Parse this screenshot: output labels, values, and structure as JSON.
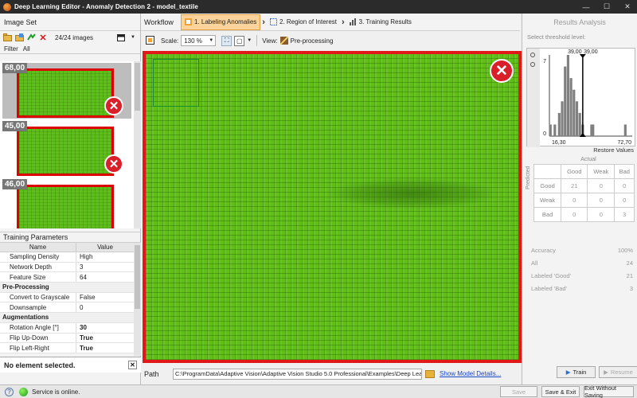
{
  "window": {
    "title": "Deep Learning Editor - Anomaly Detection 2 - model_textile",
    "minimize": "—",
    "maximize": "☐",
    "close": "✕"
  },
  "image_set": {
    "title": "Image Set",
    "count_label": "24/24 images",
    "filter_label": "Filter",
    "filter_value": "All",
    "thumbnails": [
      {
        "score": "68,00",
        "label": "bad",
        "selected": true
      },
      {
        "score": "45,00",
        "label": "bad",
        "selected": false
      },
      {
        "score": "46,00",
        "label": "bad",
        "selected": false
      }
    ]
  },
  "training_parameters": {
    "title": "Training Parameters",
    "col_name": "Name",
    "col_value": "Value",
    "rows": [
      {
        "type": "row",
        "name": "Sampling Density",
        "value": "High",
        "bold": false
      },
      {
        "type": "row",
        "name": "Network Depth",
        "value": "3",
        "bold": false
      },
      {
        "type": "row",
        "name": "Feature Size",
        "value": "64",
        "bold": false
      },
      {
        "type": "section",
        "name": "Pre-Processing"
      },
      {
        "type": "row",
        "name": "Convert to Grayscale",
        "value": "False",
        "bold": false
      },
      {
        "type": "row",
        "name": "Downsample",
        "value": "0",
        "bold": false
      },
      {
        "type": "section",
        "name": "Augmentations"
      },
      {
        "type": "row",
        "name": "Rotation Angle [°]",
        "value": "30",
        "bold": true
      },
      {
        "type": "row",
        "name": "Flip Up-Down",
        "value": "True",
        "bold": true
      },
      {
        "type": "row",
        "name": "Flip Left-Right",
        "value": "True",
        "bold": true
      }
    ],
    "no_selection": "No element selected."
  },
  "workflow": {
    "label": "Workflow",
    "steps": [
      {
        "label": "1. Labeling Anomalies",
        "active": true
      },
      {
        "label": "2. Region of Interest",
        "active": false
      },
      {
        "label": "3. Training Results",
        "active": false
      }
    ]
  },
  "view": {
    "scale_label": "Scale:",
    "scale_value": "130 %",
    "view_label": "View:",
    "preprocessing_label": "Pre-processing"
  },
  "path": {
    "label": "Path",
    "value": "C:\\ProgramData\\Adaptive Vision\\Adaptive Vision Studio 5.0 Professional\\Examples\\Deep Learning - Textiles",
    "details_link": "Show Model Details..."
  },
  "results": {
    "title": "Results Analysis",
    "threshold_label": "Select threshold level:",
    "threshold_left": "39,00",
    "threshold_right": "39,00",
    "axis_min": "16,30",
    "axis_max": "72,70",
    "y_max": "7",
    "y_min": "0",
    "restore_label": "Restore Values",
    "actual_label": "Actual",
    "predicted_label": "Predicted",
    "matrix_headers": [
      "Good",
      "Weak",
      "Bad"
    ],
    "matrix_rows": [
      {
        "label": "Good",
        "values": [
          "21",
          "0",
          "0"
        ]
      },
      {
        "label": "Weak",
        "values": [
          "0",
          "0",
          "0"
        ]
      },
      {
        "label": "Bad",
        "values": [
          "0",
          "0",
          "3"
        ]
      }
    ],
    "stats": [
      {
        "label": "Accuracy",
        "value": "100%"
      },
      {
        "label": "All",
        "value": "24"
      },
      {
        "label": "Labeled 'Good'",
        "value": "21"
      },
      {
        "label": "Labeled 'Bad'",
        "value": "3"
      }
    ],
    "train_label": "Train",
    "resume_label": "Resume"
  },
  "chart_data": {
    "type": "bar",
    "x": [
      17,
      20,
      23,
      25,
      27,
      29,
      31,
      33,
      35,
      37,
      39,
      45,
      46,
      68
    ],
    "values": [
      1,
      1,
      2,
      3,
      6,
      7,
      5,
      4,
      3,
      2,
      1,
      1,
      1,
      1
    ],
    "xlim": [
      16.3,
      72.7
    ],
    "ylim": [
      0,
      7
    ],
    "threshold": 39
  },
  "status": {
    "text": "Service is online.",
    "save": "Save",
    "save_exit": "Save & Exit",
    "exit_no_save": "Exit Without Saving"
  },
  "colors": {
    "accent_step": "#fcd49b",
    "bad_border": "#e01818",
    "bad_icon": "#d81f2a",
    "fabric": "#5fbf17"
  }
}
